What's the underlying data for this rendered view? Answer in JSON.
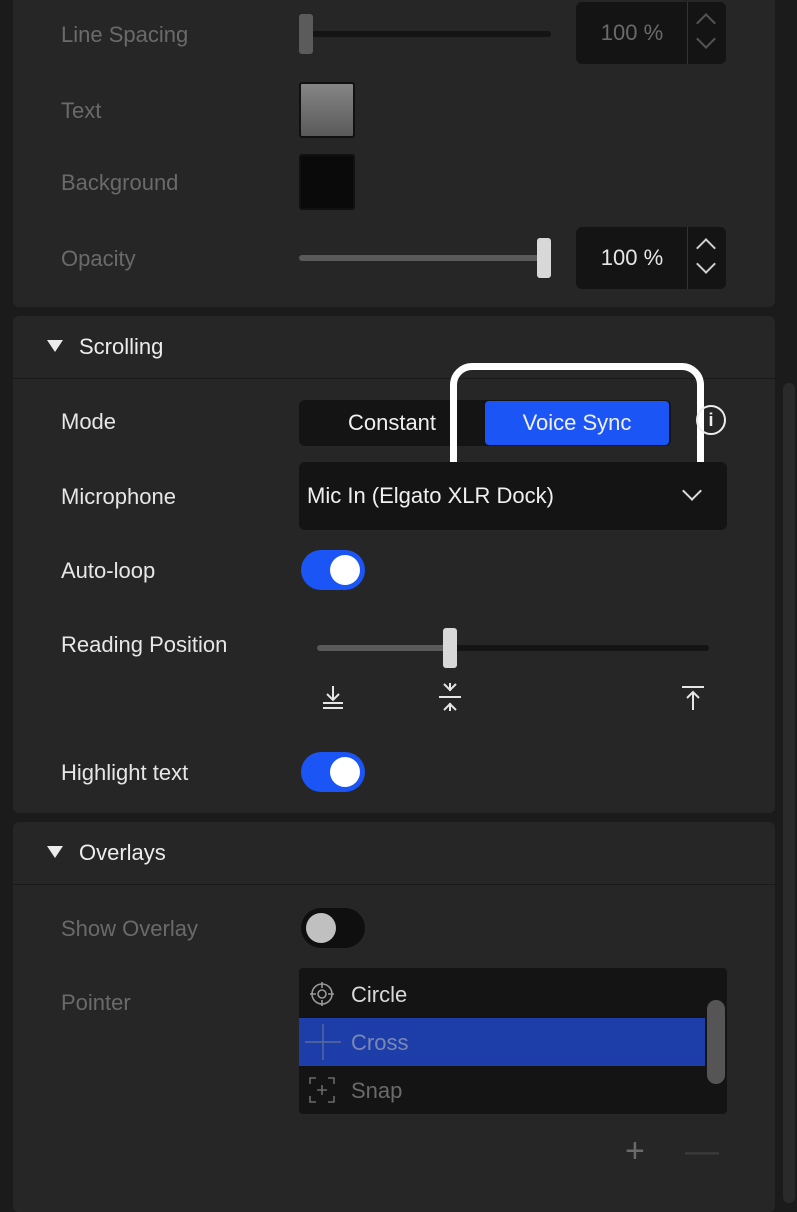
{
  "appearance": {
    "line_spacing": {
      "label": "Line Spacing",
      "value": "100 %",
      "slider": 0.0
    },
    "text": {
      "label": "Text",
      "color": "#7a7a7a"
    },
    "background": {
      "label": "Background",
      "color": "#0a0a0a"
    },
    "opacity": {
      "label": "Opacity",
      "value": "100 %",
      "slider": 1.0
    }
  },
  "scrolling": {
    "title": "Scrolling",
    "mode": {
      "label": "Mode",
      "options": [
        "Constant",
        "Voice Sync"
      ],
      "selected": "Voice Sync"
    },
    "microphone": {
      "label": "Microphone",
      "value": "Mic In (Elgato XLR Dock)"
    },
    "auto_loop": {
      "label": "Auto-loop",
      "on": true
    },
    "reading_position": {
      "label": "Reading Position",
      "slider": 0.34
    },
    "highlight_text": {
      "label": "Highlight text",
      "on": true
    }
  },
  "overlays": {
    "title": "Overlays",
    "show_overlay": {
      "label": "Show Overlay",
      "on": false
    },
    "pointer": {
      "label": "Pointer",
      "items": [
        {
          "label": "Circle",
          "icon": "crosshair-circle-icon"
        },
        {
          "label": "Cross",
          "icon": "cross-icon"
        },
        {
          "label": "Snap",
          "icon": "snap-bracket-icon"
        }
      ],
      "selected": "Cross"
    },
    "add_symbol": "+",
    "remove_symbol": "—"
  },
  "colors": {
    "accent": "#1b55f5",
    "panel": "#262626",
    "field": "#141414"
  }
}
